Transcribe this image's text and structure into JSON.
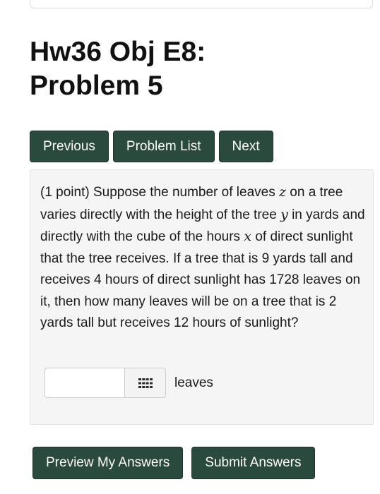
{
  "page": {
    "title_line1": "Hw36 Obj E8:",
    "title_line2": "Problem 5"
  },
  "nav": {
    "previous": "Previous",
    "problem_list": "Problem List",
    "next": "Next"
  },
  "problem": {
    "text_1": "(1 point) Suppose the number of leaves ",
    "var_z": "z",
    "text_2": " on a tree varies directly with the height of the tree ",
    "var_y": "y",
    "text_3": " in yards and directly with the cube of the hours ",
    "var_x": "x",
    "text_4": " of direct sunlight that the tree receives. If a tree that is 9 yards tall and receives 4 hours of direct sunlight has 1728 leaves on it, then how many leaves will be on a tree that is 2 yards tall but receives 12 hours of sunlight?",
    "answer_value": "",
    "answer_unit": "leaves",
    "keypad_icon": "keypad-grid-icon"
  },
  "actions": {
    "preview": "Preview My Answers",
    "submit": "Submit Answers"
  },
  "colors": {
    "button_bg": "#2b4a3e",
    "panel_bg": "#f5f5f5"
  }
}
